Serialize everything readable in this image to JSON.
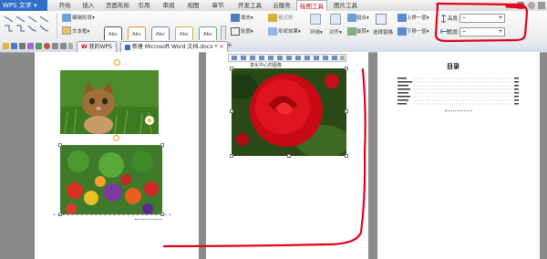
{
  "app": {
    "name": "WPS 文字",
    "dropdown_glyph": "▾"
  },
  "menu": {
    "tabs": [
      "开始",
      "插入",
      "页面布局",
      "引用",
      "审阅",
      "视图",
      "章节",
      "开发工具",
      "云服务",
      "绘图工具",
      "图片工具"
    ],
    "active_tab": "绘图工具"
  },
  "ribbon": {
    "edit_shape": "编辑形状▾",
    "text_box": "文本框▾",
    "style_label": "Abc",
    "fill": "填充▾",
    "format_painter": "格式刷",
    "outline": "轮廓▾",
    "shape_effect": "形状效果▾",
    "wrap": "环绕▾",
    "align": "对齐▾",
    "rotate": "旋转▾",
    "group": "组合▾",
    "select_pane": "选择窗格",
    "bring_forward": "上移一层▾",
    "send_backward": "下移一层▾",
    "height_label": "高度:",
    "width_label": "宽度:",
    "minus": "−",
    "plus": "+"
  },
  "doc_tabs": [
    {
      "label": "我的WPS",
      "active": false
    },
    {
      "label": "新建 Microsoft Word 文档.docx *",
      "active": true
    }
  ],
  "new_tab": "+",
  "close_glyph": "×",
  "page2": {
    "title": "变化中心的图像"
  },
  "page3": {
    "title": "目录"
  },
  "colors": {
    "annotation": "#e4001b",
    "accent": "#2f6fc7",
    "active_tab_text": "#c00000"
  }
}
